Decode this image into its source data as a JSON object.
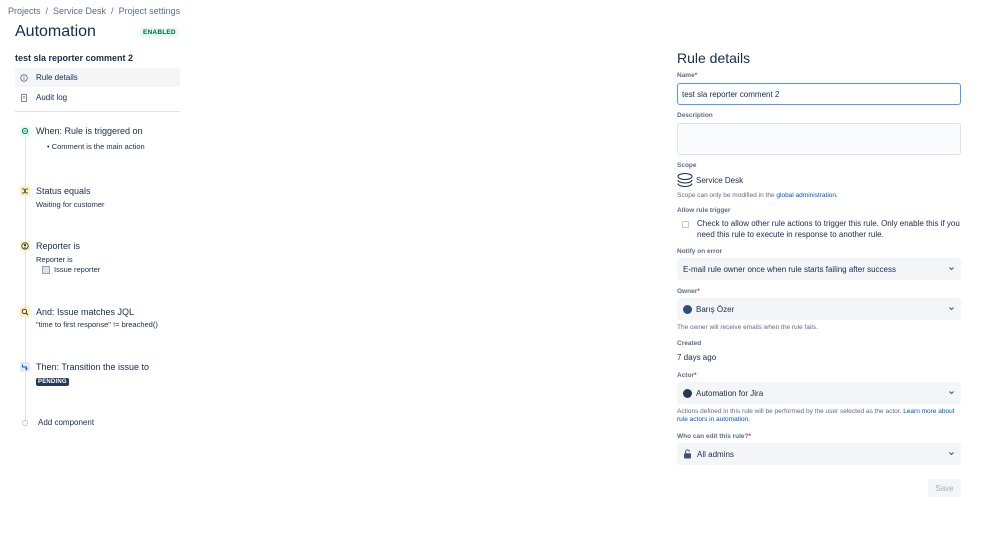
{
  "breadcrumb": [
    "Projects",
    "Service Desk",
    "Project settings"
  ],
  "page": {
    "title": "Automation",
    "status": "ENABLED",
    "rule_name": "test sla reporter comment 2"
  },
  "nav": [
    {
      "label": "Rule details",
      "icon": "info-icon",
      "active": true
    },
    {
      "label": "Audit log",
      "icon": "document-icon",
      "active": false
    }
  ],
  "components": {
    "trigger": {
      "title": "When: Rule is triggered on",
      "detail": "Comment is the main action"
    },
    "status": {
      "title": "Status equals",
      "detail": "Waiting for customer"
    },
    "reporter": {
      "title": "Reporter is",
      "line1": "Reporter is",
      "line2": "Issue reporter"
    },
    "jql": {
      "title": "And: Issue matches JQL",
      "detail": "\"time to first response\" != breached()"
    },
    "transition": {
      "title": "Then: Transition the issue to",
      "status": "PENDING"
    },
    "add_label": "Add component"
  },
  "rule_details": {
    "title": "Rule details",
    "name_label": "Name",
    "name_value": "test sla reporter comment 2",
    "description_label": "Description",
    "scope_label": "Scope",
    "scope_value": "Service Desk",
    "scope_help_prefix": "Scope can only be modified in the",
    "scope_help_link": "global administration.",
    "allow_trigger_label": "Allow rule trigger",
    "allow_trigger_text": "Check to allow other rule actions to trigger this rule. Only enable this if you need this rule to execute in response to another rule.",
    "notify_label": "Notify on error",
    "notify_value": "E-mail rule owner once when rule starts failing after success",
    "owner_label": "Owner",
    "owner_value": "Barış Özer",
    "owner_help": "The owner will receive emails when the rule fails.",
    "created_label": "Created",
    "created_value": "7 days ago",
    "actor_label": "Actor",
    "actor_value": "Automation for Jira",
    "actor_help_prefix": "Actions defined in this rule will be performed by the user selected as the actor.",
    "actor_help_link": "Learn more about rule actors in automation.",
    "edit_label": "Who can edit this rule?",
    "edit_value": "All admins",
    "save_label": "Save"
  },
  "colors": {
    "link": "#0052cc",
    "required": "#de350b",
    "enabled_bg": "#e3fcef",
    "enabled_fg": "#006644",
    "trigger_icon_bg": "#e3fcef",
    "condition_icon_bg": "#fff0b3",
    "action_icon_bg": "#deebff"
  }
}
